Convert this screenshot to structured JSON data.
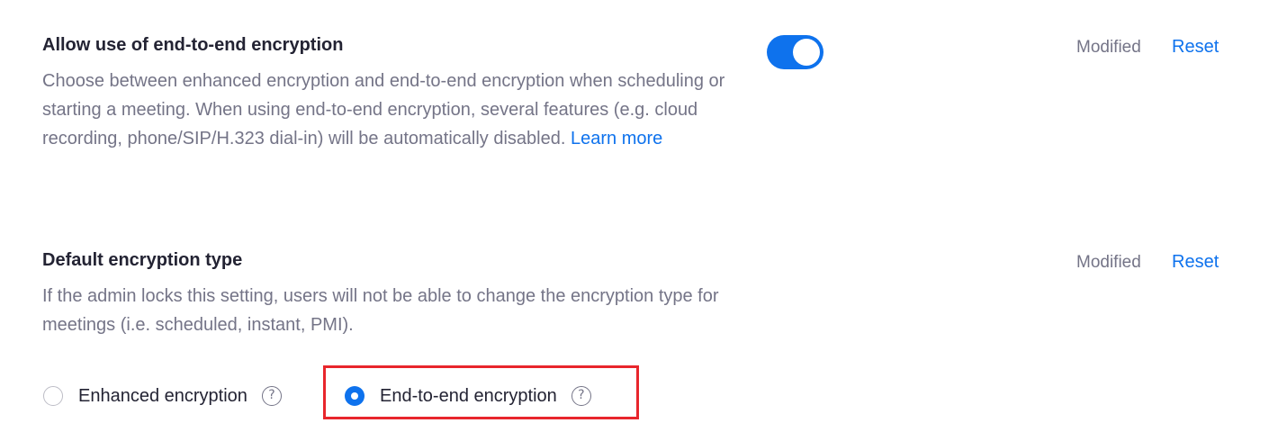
{
  "settings": [
    {
      "title": "Allow use of end-to-end encryption",
      "description": "Choose between enhanced encryption and end-to-end encryption when scheduling or starting a meeting. When using end-to-end encryption, several features (e.g. cloud recording, phone/SIP/H.323 dial-in) will be automatically disabled.",
      "learn_more": "Learn more",
      "toggle_on": true,
      "status": "Modified",
      "reset": "Reset"
    },
    {
      "title": "Default encryption type",
      "description": "If the admin locks this setting, users will not be able to change the encryption type for meetings (i.e. scheduled, instant, PMI).",
      "status": "Modified",
      "reset": "Reset",
      "options": [
        {
          "label": "Enhanced encryption",
          "selected": false
        },
        {
          "label": "End-to-end encryption",
          "selected": true
        }
      ]
    }
  ],
  "help_glyph": "?",
  "colors": {
    "accent": "#0e72ed",
    "highlight": "#e8262c"
  }
}
